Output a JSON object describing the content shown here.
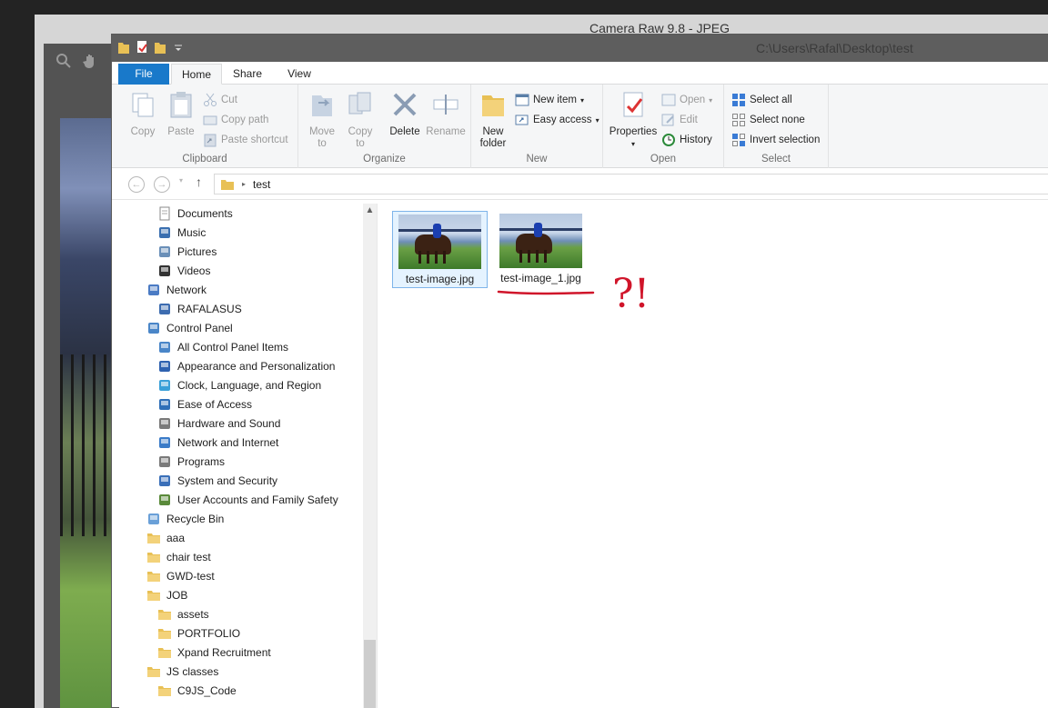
{
  "camera_raw": {
    "title": "Camera Raw 9.8  -  JPEG"
  },
  "explorer": {
    "title_path": "C:\\Users\\Rafal\\Desktop\\test",
    "tabs": [
      {
        "label": "File"
      },
      {
        "label": "Home"
      },
      {
        "label": "Share"
      },
      {
        "label": "View"
      }
    ],
    "ribbon": {
      "clipboard": {
        "label": "Clipboard",
        "copy": "Copy",
        "paste": "Paste",
        "cut": "Cut",
        "copy_path": "Copy path",
        "paste_shortcut": "Paste shortcut"
      },
      "organize": {
        "label": "Organize",
        "move_to_1": "Move",
        "move_to_2": "to",
        "copy_to_1": "Copy",
        "copy_to_2": "to",
        "delete": "Delete",
        "rename": "Rename"
      },
      "new": {
        "label": "New",
        "new_folder_1": "New",
        "new_folder_2": "folder",
        "new_item": "New item",
        "easy_access": "Easy access"
      },
      "open": {
        "label": "Open",
        "properties": "Properties",
        "open": "Open",
        "edit": "Edit",
        "history": "History"
      },
      "select": {
        "label": "Select",
        "select_all": "Select all",
        "select_none": "Select none",
        "invert_selection": "Invert selection"
      }
    },
    "address": {
      "crumb": "test"
    },
    "nav_items": [
      {
        "label": "Documents",
        "icon": "documents-icon"
      },
      {
        "label": "Music",
        "icon": "music-icon"
      },
      {
        "label": "Pictures",
        "icon": "pictures-icon"
      },
      {
        "label": "Videos",
        "icon": "videos-icon"
      },
      {
        "label": "Network",
        "icon": "network-icon"
      },
      {
        "label": "RAFALASUS",
        "icon": "computer-icon"
      },
      {
        "label": "Control Panel",
        "icon": "control-panel-icon"
      },
      {
        "label": "All Control Panel Items",
        "icon": "control-panel-icon"
      },
      {
        "label": "Appearance and Personalization",
        "icon": "appearance-icon"
      },
      {
        "label": "Clock, Language, and Region",
        "icon": "clock-icon"
      },
      {
        "label": "Ease of Access",
        "icon": "ease-of-access-icon"
      },
      {
        "label": "Hardware and Sound",
        "icon": "hardware-icon"
      },
      {
        "label": "Network and Internet",
        "icon": "network-internet-icon"
      },
      {
        "label": "Programs",
        "icon": "programs-icon"
      },
      {
        "label": "System and Security",
        "icon": "security-icon"
      },
      {
        "label": "User Accounts and Family Safety",
        "icon": "users-icon"
      },
      {
        "label": "Recycle Bin",
        "icon": "recycle-bin-icon"
      },
      {
        "label": "aaa",
        "icon": "folder-icon"
      },
      {
        "label": "chair test",
        "icon": "folder-icon"
      },
      {
        "label": "GWD-test",
        "icon": "folder-icon"
      },
      {
        "label": "JOB",
        "icon": "folder-icon"
      },
      {
        "label": "assets",
        "icon": "folder-icon"
      },
      {
        "label": "PORTFOLIO",
        "icon": "folder-icon"
      },
      {
        "label": "Xpand Recruitment",
        "icon": "folder-icon"
      },
      {
        "label": "JS classes",
        "icon": "folder-icon"
      },
      {
        "label": "C9JS_Code",
        "icon": "folder-icon"
      }
    ],
    "files": [
      {
        "name": "test-image.jpg"
      },
      {
        "name": "test-image_1.jpg"
      }
    ],
    "annotation": {
      "text": "?!"
    }
  }
}
